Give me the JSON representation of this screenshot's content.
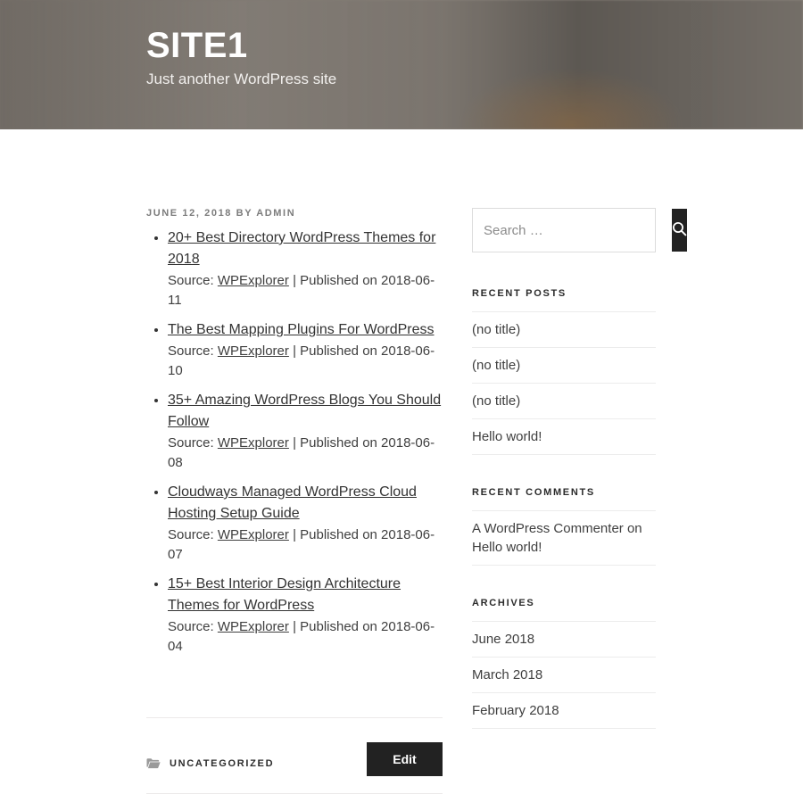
{
  "header": {
    "site_title": "SITE1",
    "site_description": "Just another WordPress site"
  },
  "post": {
    "meta": "JUNE 12, 2018 BY ADMIN",
    "items": [
      {
        "title": "20+ Best Directory WordPress Themes for 2018",
        "source_prefix": "Source:",
        "source_name": "WPExplorer",
        "published": "| Published on 2018-06-11"
      },
      {
        "title": "The Best Mapping Plugins For WordPress",
        "source_prefix": "Source:",
        "source_name": "WPExplorer",
        "published": "| Published on 2018-06-10"
      },
      {
        "title": "35+ Amazing WordPress Blogs You Should Follow",
        "source_prefix": "Source:",
        "source_name": "WPExplorer",
        "published": "| Published on 2018-06-08"
      },
      {
        "title": "Cloudways Managed WordPress Cloud Hosting Setup Guide",
        "source_prefix": "Source:",
        "source_name": "WPExplorer",
        "published": "| Published on 2018-06-07"
      },
      {
        "title": "15+ Best Interior Design Architecture Themes for WordPress",
        "source_prefix": "Source:",
        "source_name": "WPExplorer",
        "published": "| Published on 2018-06-04"
      }
    ],
    "footer": {
      "category_icon": "folder-icon",
      "category": "UNCATEGORIZED",
      "edit_label": "Edit"
    }
  },
  "sidebar": {
    "search": {
      "placeholder": "Search …",
      "value": "",
      "button_icon": "search-icon"
    },
    "recent_posts": {
      "title": "RECENT POSTS",
      "items": [
        "(no title)",
        "(no title)",
        "(no title)",
        "Hello world!"
      ]
    },
    "recent_comments": {
      "title": "RECENT COMMENTS",
      "items": [
        {
          "author": "A WordPress Commenter",
          "connector": "on",
          "post": "Hello world!"
        }
      ]
    },
    "archives": {
      "title": "ARCHIVES",
      "items": [
        "June 2018",
        "March 2018",
        "February 2018"
      ]
    }
  },
  "colors": {
    "accent_dark": "#222222",
    "text": "#333333",
    "muted": "#7c7c7c",
    "divider": "#ececec"
  }
}
